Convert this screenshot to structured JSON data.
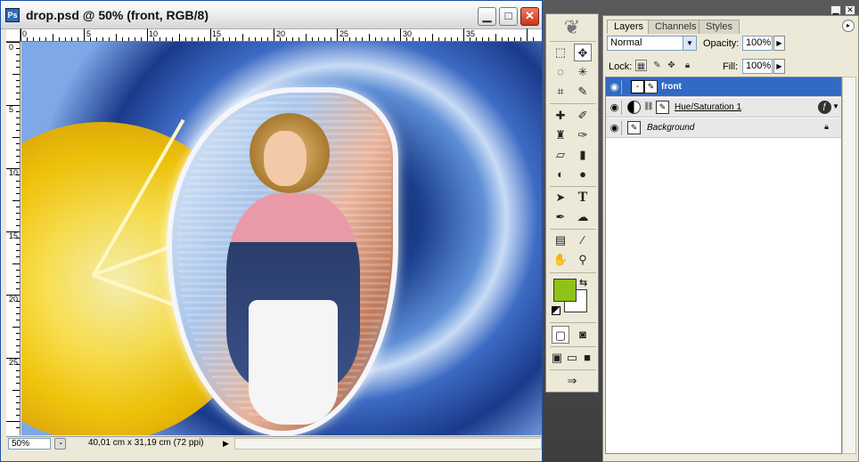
{
  "document": {
    "title": "drop.psd @ 50% (front, RGB/8)",
    "app_icon": "photoshop-doc-icon",
    "controls": {
      "minimize": "minimize-icon",
      "maximize": "maximize-icon",
      "close": "close-icon"
    },
    "ruler_top_labels": [
      "0",
      "5",
      "10",
      "15",
      "20",
      "25",
      "30",
      "35"
    ],
    "ruler_left_labels": [
      "0",
      "5",
      "10",
      "15",
      "20",
      "25"
    ],
    "status": {
      "zoom": "50%",
      "doc_info": "40,01 cm x 31,19 cm (72 ppi)"
    }
  },
  "toolbox": {
    "tools": [
      "marquee-icon",
      "move-icon",
      "lasso-icon",
      "magic-wand-icon",
      "crop-icon",
      "slice-icon",
      "healing-icon",
      "brush-icon",
      "stamp-icon",
      "history-brush-icon",
      "eraser-icon",
      "gradient-icon",
      "blur-icon",
      "burn-icon",
      "path-select-icon",
      "type-icon",
      "pen-icon",
      "shape-icon",
      "notes-icon",
      "eyedropper-icon",
      "hand-icon",
      "zoom-icon"
    ],
    "foreground_color": "#8dc21b",
    "background_color": "#ffffff"
  },
  "layers_panel": {
    "tabs": [
      "Layers",
      "Channels",
      "Styles"
    ],
    "active_tab": "Layers",
    "blend_mode": "Normal",
    "opacity_label": "Opacity:",
    "opacity": "100%",
    "lock_label": "Lock:",
    "fill_label": "Fill:",
    "fill": "100%",
    "layers": [
      {
        "name": "front",
        "selected": true,
        "visible": true
      },
      {
        "name": "Hue/Saturation 1",
        "selected": false,
        "visible": true
      },
      {
        "name": "Background",
        "selected": false,
        "visible": true
      }
    ],
    "selection_color": "#316ac5"
  }
}
